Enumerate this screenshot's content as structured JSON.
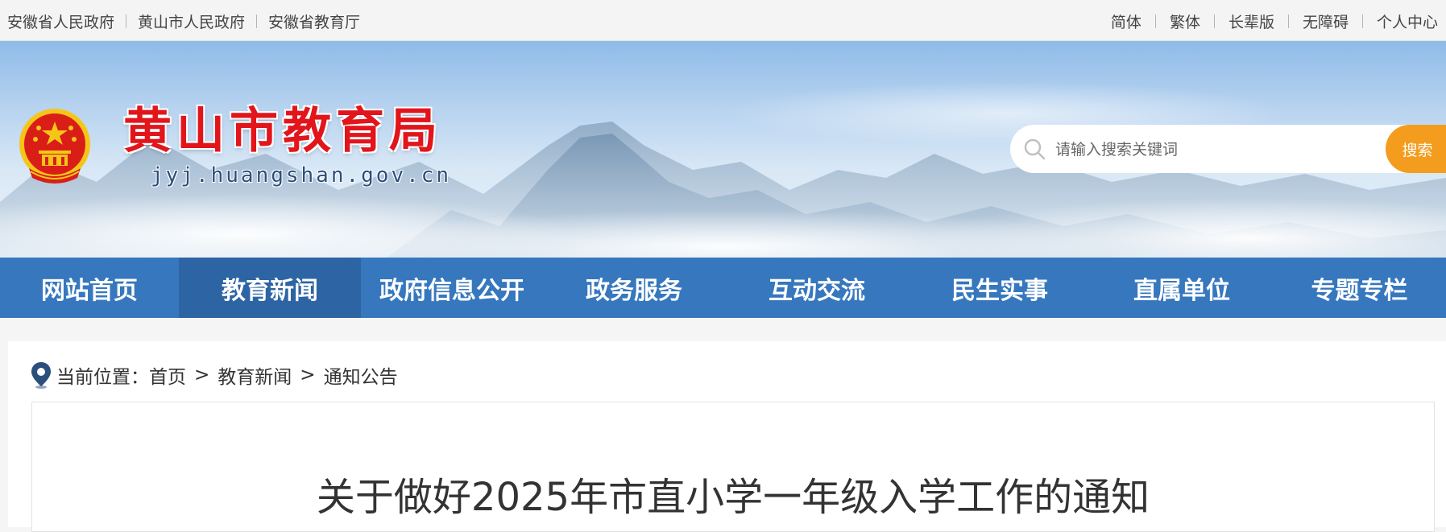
{
  "topbar": {
    "left_links": [
      "安徽省人民政府",
      "黄山市人民政府",
      "安徽省教育厅"
    ],
    "right_links": [
      "简体",
      "繁体",
      "长辈版",
      "无障碍",
      "个人中心"
    ]
  },
  "header": {
    "title": "黄山市教育局",
    "domain": "jyj.huangshan.gov.cn",
    "search": {
      "placeholder": "请输入搜索关键词",
      "button": "搜索"
    }
  },
  "nav": {
    "items": [
      "网站首页",
      "教育新闻",
      "政府信息公开",
      "政务服务",
      "互动交流",
      "民生实事",
      "直属单位",
      "专题专栏"
    ],
    "active_index": 1
  },
  "breadcrumb": {
    "label": "当前位置：",
    "items": [
      "首页",
      "教育新闻",
      "通知公告"
    ],
    "separator": ">"
  },
  "article": {
    "title": "关于做好2025年市直小学一年级入学工作的通知"
  },
  "colors": {
    "nav_bg": "#3677be",
    "nav_active": "#2d64a4",
    "title_red": "#e1151b",
    "search_button": "#f39c1d"
  },
  "icons": [
    "national-emblem-icon",
    "search-icon",
    "location-pin-icon"
  ]
}
